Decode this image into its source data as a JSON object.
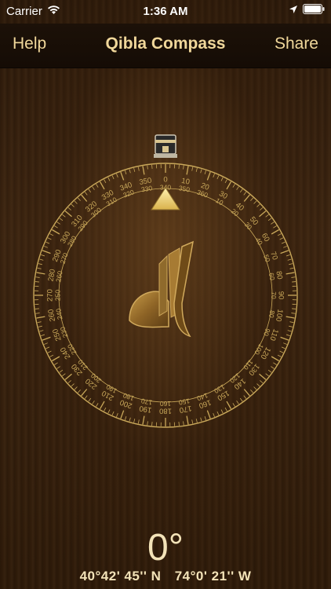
{
  "status_bar": {
    "carrier": "Carrier",
    "time": "1:36 AM",
    "icons": [
      "wifi-icon",
      "location-arrow-icon",
      "battery-icon"
    ]
  },
  "nav": {
    "left_button": "Help",
    "title": "Qibla Compass",
    "right_button": "Share"
  },
  "compass": {
    "tick_labels": [
      "0",
      "10",
      "20",
      "30",
      "40",
      "50",
      "60",
      "70",
      "80",
      "90",
      "100",
      "110",
      "120",
      "130",
      "140",
      "150",
      "160",
      "170",
      "180",
      "190",
      "200",
      "210",
      "220",
      "230",
      "240",
      "250",
      "260",
      "270",
      "280",
      "290",
      "300",
      "310",
      "320",
      "330",
      "340",
      "350"
    ],
    "inner_labels": [
      "360",
      "10",
      "20",
      "30",
      "40",
      "50",
      "60",
      "70",
      "80",
      "90",
      "100",
      "110",
      "120",
      "130",
      "140",
      "150",
      "160",
      "170",
      "180",
      "190",
      "200",
      "210",
      "220",
      "230",
      "240",
      "250",
      "260",
      "270",
      "280",
      "290",
      "300",
      "310",
      "320",
      "330",
      "340",
      "350"
    ],
    "needle_icon": "qibla-needle-icon",
    "marker_icon": "kaaba-icon",
    "pointer_icon": "triangle-pointer-icon"
  },
  "readout": {
    "heading": "0°",
    "latitude": "40°42' 45'' N",
    "longitude": "74°0' 21'' W"
  },
  "colors": {
    "accent": "#f0d79a",
    "dial": "#c9a85a",
    "text": "#f3e3b8"
  }
}
